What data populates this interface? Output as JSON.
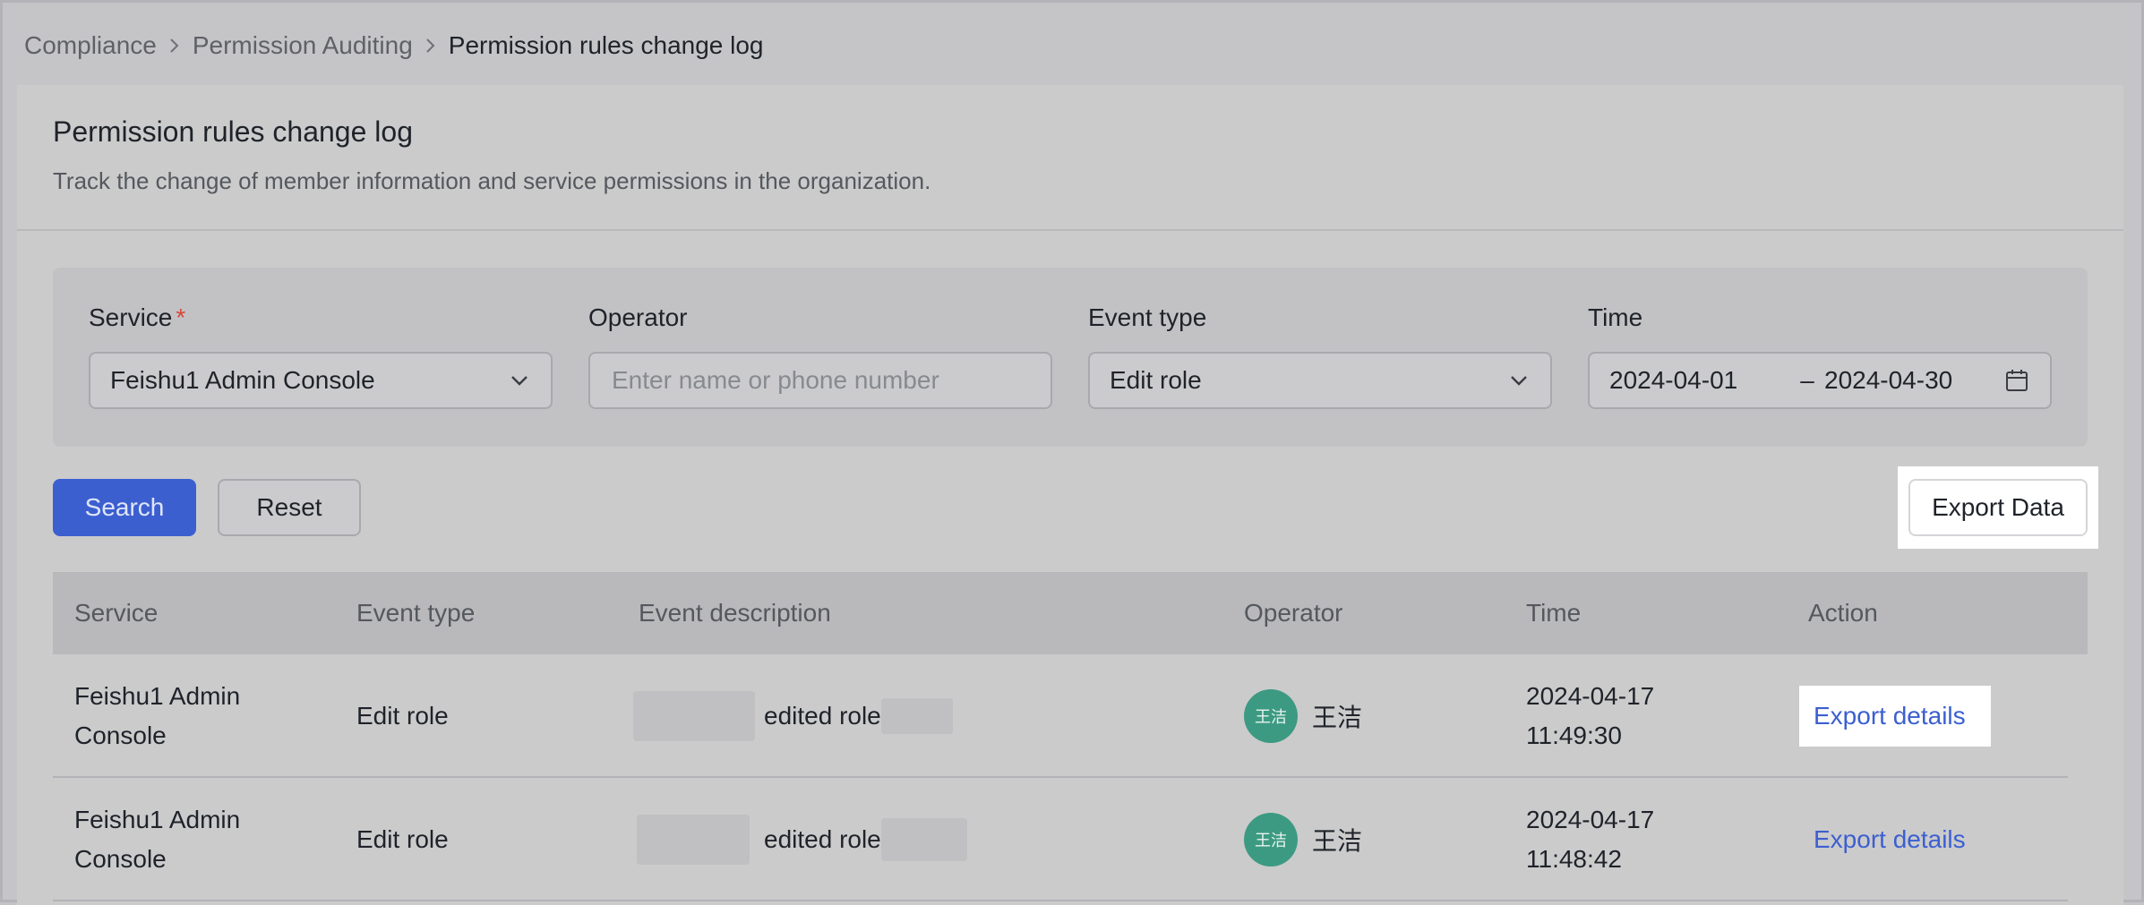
{
  "breadcrumb": {
    "items": [
      "Compliance",
      "Permission Auditing",
      "Permission rules change log"
    ]
  },
  "header": {
    "title": "Permission rules change log",
    "description": "Track the change of member information and service permissions in the organization."
  },
  "filters": {
    "service": {
      "label": "Service",
      "required_mark": "*",
      "value": "Feishu1 Admin Console"
    },
    "operator": {
      "label": "Operator",
      "placeholder": "Enter name or phone number",
      "value": ""
    },
    "event_type": {
      "label": "Event type",
      "value": "Edit role"
    },
    "time": {
      "label": "Time",
      "start": "2024-04-01",
      "separator": "–",
      "end": "2024-04-30"
    }
  },
  "buttons": {
    "search": "Search",
    "reset": "Reset",
    "export": "Export Data"
  },
  "table": {
    "columns": [
      "Service",
      "Event type",
      "Event description",
      "Operator",
      "Time",
      "Action"
    ],
    "rows": [
      {
        "service_line1": "Feishu1 Admin",
        "service_line2": "Console",
        "event_type": "Edit role",
        "description": "edited role",
        "operator_avatar": "王洁",
        "operator_name": "王洁",
        "time_date": "2024-04-17",
        "time_clock": "11:49:30",
        "action": "Export details"
      },
      {
        "service_line1": "Feishu1 Admin",
        "service_line2": "Console",
        "event_type": "Edit role",
        "description": "edited role",
        "operator_avatar": "王洁",
        "operator_name": "王洁",
        "time_date": "2024-04-17",
        "time_clock": "11:48:42",
        "action": "Export details"
      }
    ]
  },
  "colors": {
    "primary": "#3c5fd0",
    "avatar": "#3d9a82",
    "required": "#d9453a"
  },
  "icons": {
    "breadcrumb_separator": "chevron-right-icon",
    "dropdown": "chevron-down-icon",
    "calendar": "calendar-icon"
  }
}
